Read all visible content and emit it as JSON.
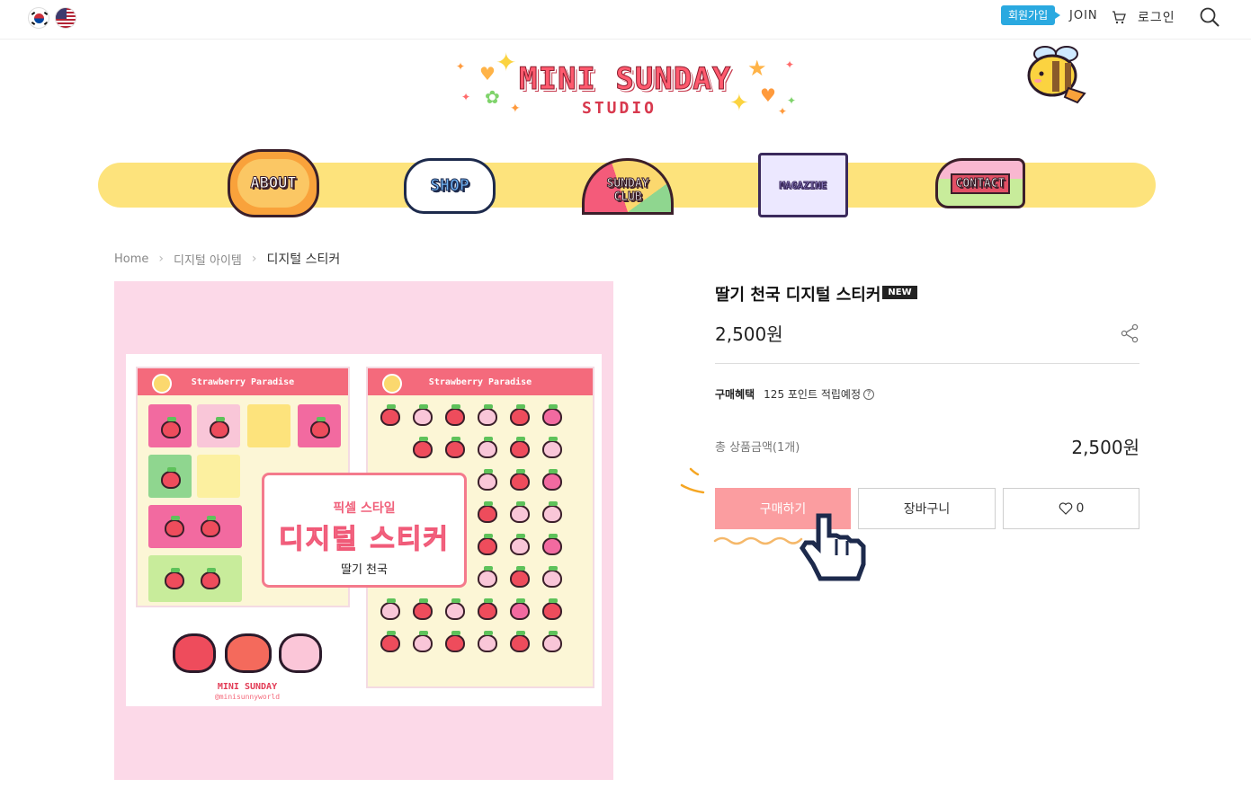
{
  "topbar": {
    "signup_badge": "회원가입",
    "join": "JOIN",
    "login": "로그인"
  },
  "logo": {
    "main": "MINI SUNDAY",
    "sub": "STUDIO"
  },
  "nav": {
    "about": "ABOUT",
    "shop": "SHOP",
    "club_line1": "SUNDAY",
    "club_line2": "CLUB",
    "magazine": "MAGAZINE",
    "contact": "CONTACT"
  },
  "breadcrumb": {
    "home": "Home",
    "category": "디지털 아이템",
    "current": "디지털 스티커"
  },
  "image": {
    "sheet_title_left": "Strawberry Paradise",
    "sheet_title_right": "Strawberry Paradise",
    "overlay_line1": "픽셀 스타일",
    "overlay_line2": "디지털 스티커",
    "overlay_line3": "딸기 천국",
    "brand": "MINI SUNDAY",
    "brand_handle": "@minisunnyworld"
  },
  "product": {
    "title": "딸기 천국 디지털 스티커",
    "badge": "NEW",
    "price": "2,500원",
    "benefit_label": "구매혜택",
    "benefit_value": "125 포인트 적립예정",
    "total_label": "총 상품금액(1개)",
    "total_price": "2,500원"
  },
  "actions": {
    "buy": "구매하기",
    "cart": "장바구니",
    "like_count": "0"
  },
  "colors": {
    "nav_bar": "#fde37c",
    "buy_button": "#fb9da0",
    "image_bg": "#fcd9e8",
    "signup_badge": "#2aa9e0"
  },
  "icons": [
    "korea-flag-icon",
    "usa-flag-icon",
    "cart-icon",
    "search-icon",
    "share-icon",
    "help-icon",
    "heart-icon",
    "pointer-hand-icon"
  ]
}
